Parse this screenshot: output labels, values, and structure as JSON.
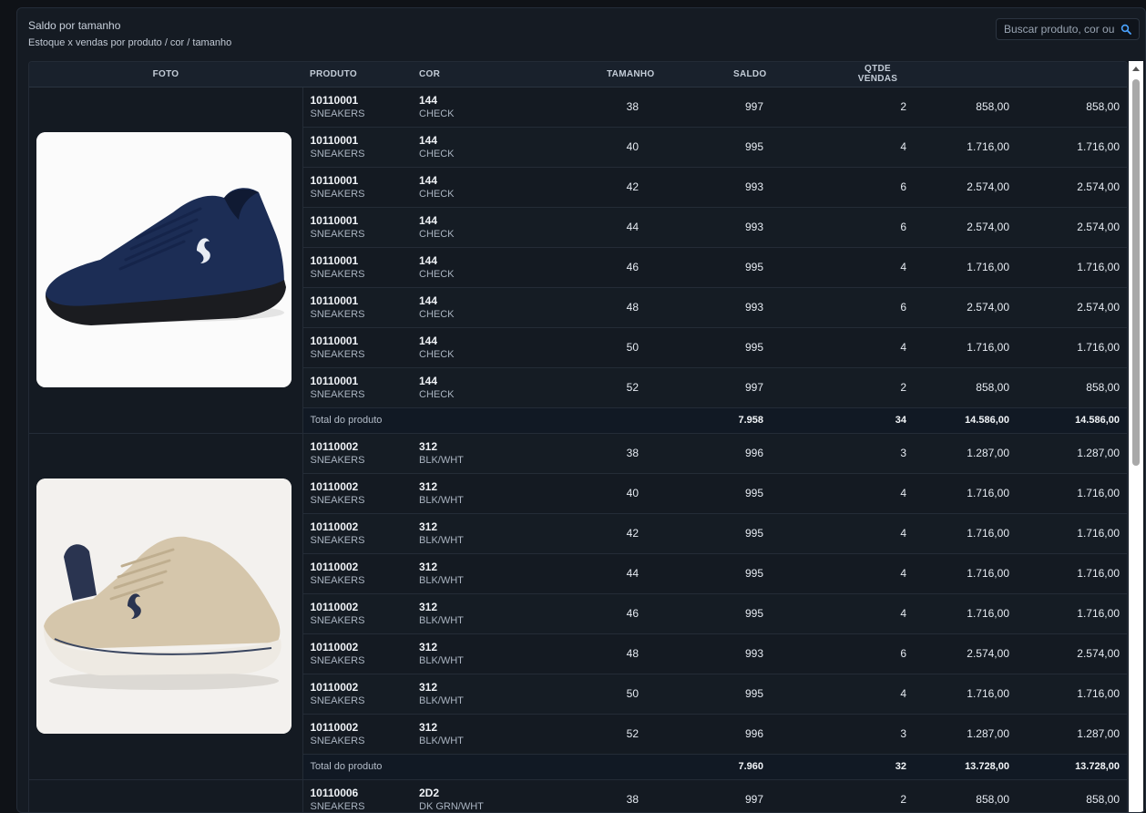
{
  "header": {
    "title": "Saldo por tamanho",
    "subtitle": "Estoque x vendas por produto / cor / tamanho",
    "search_placeholder": "Buscar produto, cor ou ..."
  },
  "columns": [
    "FOTO",
    "PRODUTO",
    "COR",
    "TAMANHO",
    "SALDO",
    "QTDE VENDAS",
    "",
    ""
  ],
  "groups": [
    {
      "image": "navy-sneaker-image",
      "rows": [
        {
          "code": "10110001",
          "cat": "SNEAKERS",
          "color_code": "144",
          "color_name": "CHECK",
          "size": "38",
          "saldo": "997",
          "vendas": "2",
          "v1": "858,00",
          "v2": "858,00"
        },
        {
          "code": "10110001",
          "cat": "SNEAKERS",
          "color_code": "144",
          "color_name": "CHECK",
          "size": "40",
          "saldo": "995",
          "vendas": "4",
          "v1": "1.716,00",
          "v2": "1.716,00"
        },
        {
          "code": "10110001",
          "cat": "SNEAKERS",
          "color_code": "144",
          "color_name": "CHECK",
          "size": "42",
          "saldo": "993",
          "vendas": "6",
          "v1": "2.574,00",
          "v2": "2.574,00"
        },
        {
          "code": "10110001",
          "cat": "SNEAKERS",
          "color_code": "144",
          "color_name": "CHECK",
          "size": "44",
          "saldo": "993",
          "vendas": "6",
          "v1": "2.574,00",
          "v2": "2.574,00"
        },
        {
          "code": "10110001",
          "cat": "SNEAKERS",
          "color_code": "144",
          "color_name": "CHECK",
          "size": "46",
          "saldo": "995",
          "vendas": "4",
          "v1": "1.716,00",
          "v2": "1.716,00"
        },
        {
          "code": "10110001",
          "cat": "SNEAKERS",
          "color_code": "144",
          "color_name": "CHECK",
          "size": "48",
          "saldo": "993",
          "vendas": "6",
          "v1": "2.574,00",
          "v2": "2.574,00"
        },
        {
          "code": "10110001",
          "cat": "SNEAKERS",
          "color_code": "144",
          "color_name": "CHECK",
          "size": "50",
          "saldo": "995",
          "vendas": "4",
          "v1": "1.716,00",
          "v2": "1.716,00"
        },
        {
          "code": "10110001",
          "cat": "SNEAKERS",
          "color_code": "144",
          "color_name": "CHECK",
          "size": "52",
          "saldo": "997",
          "vendas": "2",
          "v1": "858,00",
          "v2": "858,00"
        }
      ],
      "total": {
        "label": "Total do produto",
        "saldo": "7.958",
        "vendas": "34",
        "v1": "14.586,00",
        "v2": "14.586,00"
      }
    },
    {
      "image": "beige-sneaker-image",
      "rows": [
        {
          "code": "10110002",
          "cat": "SNEAKERS",
          "color_code": "312",
          "color_name": "BLK/WHT",
          "size": "38",
          "saldo": "996",
          "vendas": "3",
          "v1": "1.287,00",
          "v2": "1.287,00"
        },
        {
          "code": "10110002",
          "cat": "SNEAKERS",
          "color_code": "312",
          "color_name": "BLK/WHT",
          "size": "40",
          "saldo": "995",
          "vendas": "4",
          "v1": "1.716,00",
          "v2": "1.716,00"
        },
        {
          "code": "10110002",
          "cat": "SNEAKERS",
          "color_code": "312",
          "color_name": "BLK/WHT",
          "size": "42",
          "saldo": "995",
          "vendas": "4",
          "v1": "1.716,00",
          "v2": "1.716,00"
        },
        {
          "code": "10110002",
          "cat": "SNEAKERS",
          "color_code": "312",
          "color_name": "BLK/WHT",
          "size": "44",
          "saldo": "995",
          "vendas": "4",
          "v1": "1.716,00",
          "v2": "1.716,00"
        },
        {
          "code": "10110002",
          "cat": "SNEAKERS",
          "color_code": "312",
          "color_name": "BLK/WHT",
          "size": "46",
          "saldo": "995",
          "vendas": "4",
          "v1": "1.716,00",
          "v2": "1.716,00"
        },
        {
          "code": "10110002",
          "cat": "SNEAKERS",
          "color_code": "312",
          "color_name": "BLK/WHT",
          "size": "48",
          "saldo": "993",
          "vendas": "6",
          "v1": "2.574,00",
          "v2": "2.574,00"
        },
        {
          "code": "10110002",
          "cat": "SNEAKERS",
          "color_code": "312",
          "color_name": "BLK/WHT",
          "size": "50",
          "saldo": "995",
          "vendas": "4",
          "v1": "1.716,00",
          "v2": "1.716,00"
        },
        {
          "code": "10110002",
          "cat": "SNEAKERS",
          "color_code": "312",
          "color_name": "BLK/WHT",
          "size": "52",
          "saldo": "996",
          "vendas": "3",
          "v1": "1.287,00",
          "v2": "1.287,00"
        }
      ],
      "total": {
        "label": "Total do produto",
        "saldo": "7.960",
        "vendas": "32",
        "v1": "13.728,00",
        "v2": "13.728,00"
      }
    },
    {
      "image": "",
      "rows": [
        {
          "code": "10110006",
          "cat": "SNEAKERS",
          "color_code": "2D2",
          "color_name": "DK GRN/WHT",
          "size": "38",
          "saldo": "997",
          "vendas": "2",
          "v1": "858,00",
          "v2": "858,00"
        }
      ]
    }
  ],
  "colors": {
    "background": "#0f1217",
    "panel": "#151b23",
    "header_row": "#19212c",
    "total_row": "#111924",
    "navy_shoe": "#1c2d55",
    "beige_shoe": "#d5c6ab"
  }
}
